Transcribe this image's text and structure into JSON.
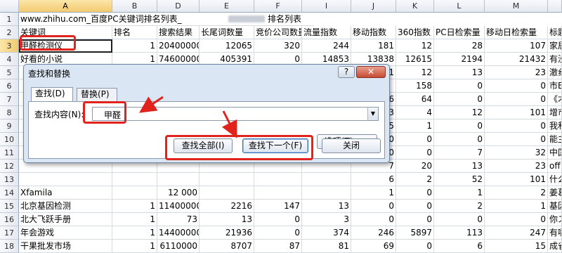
{
  "sheet": {
    "title_text": "www.zhihu.com_百度PC关键词排名列表_",
    "title_suffix": "排名列表",
    "columns": [
      "A",
      "B",
      "D",
      "E",
      "F",
      "I",
      "J",
      "K",
      "L",
      "M",
      ""
    ],
    "rows": [
      "1",
      "2",
      "3",
      "4",
      "5",
      "6",
      "7",
      "8",
      "9",
      "10",
      "11",
      "12",
      "13",
      "14",
      "15",
      "16",
      "17",
      "18"
    ],
    "headers": [
      "关键词",
      "排名",
      "搜索结果",
      "长尾词数量",
      "竞价公司数量",
      "流量指数",
      "移动指数",
      "360指数",
      "PC日检索量",
      "移动日检索量",
      "标题"
    ],
    "data": [
      [
        "甲醛检测仪",
        "1",
        "20400000",
        "12065",
        "320",
        "244",
        "181",
        "12",
        "28",
        "107",
        "家居"
      ],
      [
        "好看的小说",
        "1",
        "74600000",
        "405391",
        "0",
        "14853",
        "13838",
        "12615",
        "2194",
        "21432",
        "有没"
      ],
      [
        "",
        "",
        "",
        "",
        "",
        "",
        "1",
        "12",
        "13",
        "23",
        "澈纟"
      ],
      [
        "",
        "",
        "",
        "",
        "",
        "",
        "",
        "158",
        "0",
        "0",
        "市E"
      ],
      [
        "",
        "",
        "",
        "",
        "",
        "",
        "6",
        "64",
        "0",
        "0",
        "《才"
      ],
      [
        "",
        "",
        "",
        "",
        "",
        "",
        "3",
        "4",
        "12",
        "101",
        "增市"
      ],
      [
        "",
        "",
        "",
        "",
        "",
        "",
        "5",
        "1",
        "0",
        "0",
        "我和"
      ],
      [
        "",
        "",
        "",
        "",
        "",
        "",
        "0",
        "0",
        "0",
        "0",
        "能主"
      ],
      [
        "",
        "",
        "",
        "",
        "",
        "",
        "0",
        "0",
        "7",
        "32",
        "中国"
      ],
      [
        "",
        "",
        "",
        "",
        "",
        "",
        "7",
        "20",
        "13",
        "23",
        "off"
      ],
      [
        "",
        "",
        "",
        "",
        "",
        "",
        "6",
        "2",
        "52",
        "101",
        "什么"
      ],
      [
        "",
        "",
        "",
        "",
        "",
        "",
        "1",
        "0",
        "1",
        "2",
        "姜葛"
      ],
      [
        "北京基因检测",
        "1",
        "11400000",
        "2216",
        "147",
        "13",
        "0",
        "0",
        "2",
        "1",
        "基因"
      ],
      [
        "北大飞跃手册",
        "1",
        "73",
        "13",
        "0",
        "3",
        "0",
        "0",
        "0",
        "0",
        "你ス"
      ],
      [
        "年会游戏",
        "1",
        "14400000",
        "21936",
        "0",
        "374",
        "246",
        "5897",
        "113",
        "247",
        "有哪"
      ],
      [
        "干果批发市场",
        "1",
        "6110000",
        "8707",
        "87",
        "81",
        "69",
        "0",
        "6",
        "15",
        "成省"
      ]
    ],
    "row14_A": "Xfamila",
    "row14_D": "12 000"
  },
  "dialog": {
    "title": "查找和替换",
    "help_label": "?",
    "close_label": "✕",
    "tab_find": "查找(D)",
    "tab_replace": "替换(P)",
    "find_label": "查找内容(N):",
    "find_value": "甲醛",
    "options_button": "选项(T) >>",
    "find_all_button": "查找全部(I)",
    "find_next_button": "查找下一个(F)",
    "close_button": "关闭"
  },
  "colors": {
    "annotation": "#e0231c",
    "selected_header": "#f2c970"
  }
}
